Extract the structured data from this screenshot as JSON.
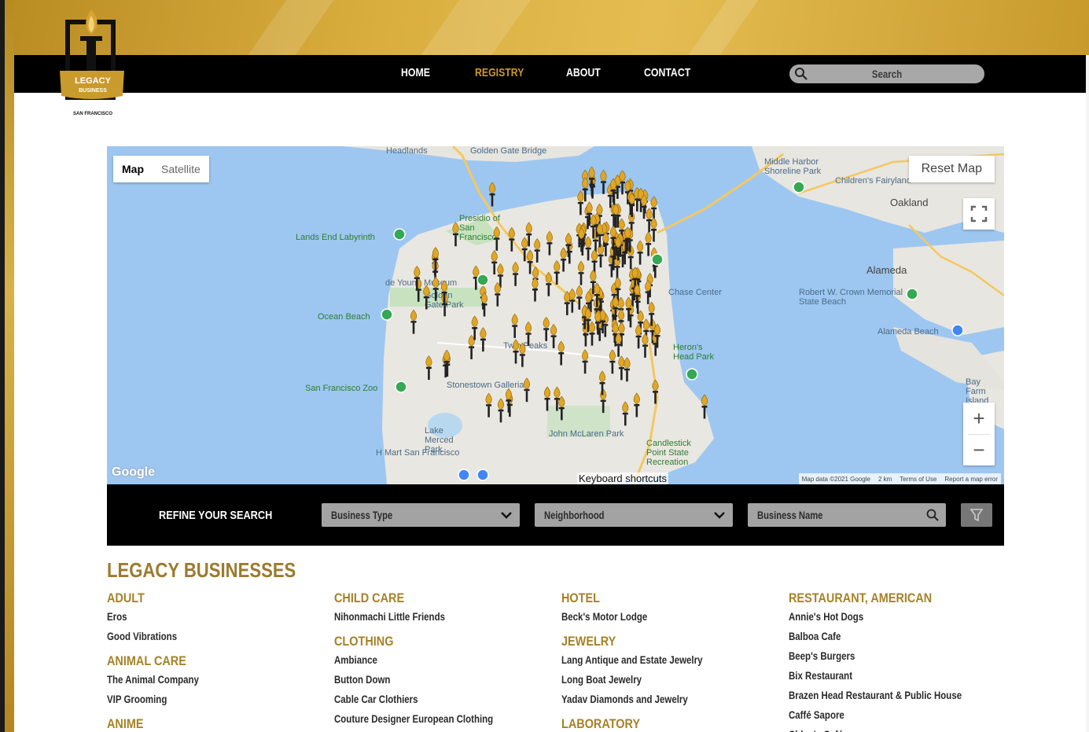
{
  "nav": {
    "items": [
      {
        "label": "HOME",
        "active": false
      },
      {
        "label": "REGISTRY",
        "active": true
      },
      {
        "label": "ABOUT",
        "active": false
      },
      {
        "label": "CONTACT",
        "active": false
      }
    ],
    "search_placeholder": "Search"
  },
  "logo": {
    "line1": "LEGACY",
    "line2": "BUSINESS",
    "city": "SAN FRANCISCO"
  },
  "map": {
    "map_type_selected": "Map",
    "map_type_other": "Satellite",
    "reset_label": "Reset Map",
    "zoom_in": "+",
    "zoom_out": "−",
    "keyboard_shortcuts": "Keyboard shortcuts",
    "attribution": [
      "Map data ©2021 Google",
      "2 km",
      "Terms of Use",
      "Report a map error"
    ],
    "google": "Google",
    "labels": {
      "golden_gate": "Golden Gate Bridge",
      "headlands": "Headlands",
      "middle_harbor": "Middle Harbor Shoreline Park",
      "childrens_fairyland": "Children's Fairyland",
      "oakland": "Oakland",
      "alameda": "Alameda",
      "lands_end": "Lands End Labyrinth",
      "presidio": "Presidio of San Francisco",
      "de_young": "de Young Museum",
      "golden_gate_park": "Golden Gate Park",
      "ocean_beach": "Ocean Beach",
      "chase_center": "Chase Center",
      "crown_beach": "Robert W. Crown Memorial State Beach",
      "alameda_beach": "Alameda Beach",
      "twin_peaks": "Twin Peaks",
      "herons_head": "Heron's Head Park",
      "sf_zoo": "San Francisco Zoo",
      "stonestown": "Stonestown Galleria",
      "lake_merced": "Lake Merced Park",
      "john_mclaren": "John McLaren Park",
      "candlestick": "Candlestick Point State Recreation",
      "bay_farm": "Bay Farm Island",
      "hmart": "H Mart San Francisco"
    }
  },
  "refine": {
    "title": "REFINE YOUR SEARCH",
    "business_type": "Business Type",
    "neighborhood": "Neighborhood",
    "business_name": "Business Name"
  },
  "listing": {
    "heading": "LEGACY BUSINESSES",
    "columns": [
      [
        {
          "title": "ADULT",
          "items": [
            "Eros",
            "Good Vibrations"
          ]
        },
        {
          "title": "ANIMAL CARE",
          "items": [
            "The Animal Company",
            "VIP Grooming"
          ]
        },
        {
          "title": "ANIME",
          "items": []
        }
      ],
      [
        {
          "title": "CHILD CARE",
          "items": [
            "Nihonmachi Little Friends"
          ]
        },
        {
          "title": "CLOTHING",
          "items": [
            "Ambiance",
            "Button Down",
            "Cable Car Clothiers",
            "Couture Designer European Clothing"
          ]
        }
      ],
      [
        {
          "title": "HOTEL",
          "items": [
            "Beck's Motor Lodge"
          ]
        },
        {
          "title": "JEWELRY",
          "items": [
            "Lang Antique and Estate Jewelry",
            "Long Boat Jewelry",
            "Yadav Diamonds and Jewelry"
          ]
        },
        {
          "title": "LABORATORY",
          "items": []
        }
      ],
      [
        {
          "title": "RESTAURANT, AMERICAN",
          "items": [
            "Annie's Hot Dogs",
            "Balboa Cafe",
            "Beep's Burgers",
            "Bix Restaurant",
            "Brazen Head Restaurant & Public House",
            "Caffé Sapore",
            "Chloe's Café"
          ]
        }
      ]
    ]
  },
  "colors": {
    "gold": "#c9992b",
    "heading_gold": "#9c7a2e",
    "nav_bg": "#000000",
    "water": "#9dc7f0"
  },
  "icons": [
    "search-icon",
    "chevron-down-icon",
    "fullscreen-icon",
    "filter-icon",
    "torch-marker-icon",
    "torch-logo-icon"
  ]
}
